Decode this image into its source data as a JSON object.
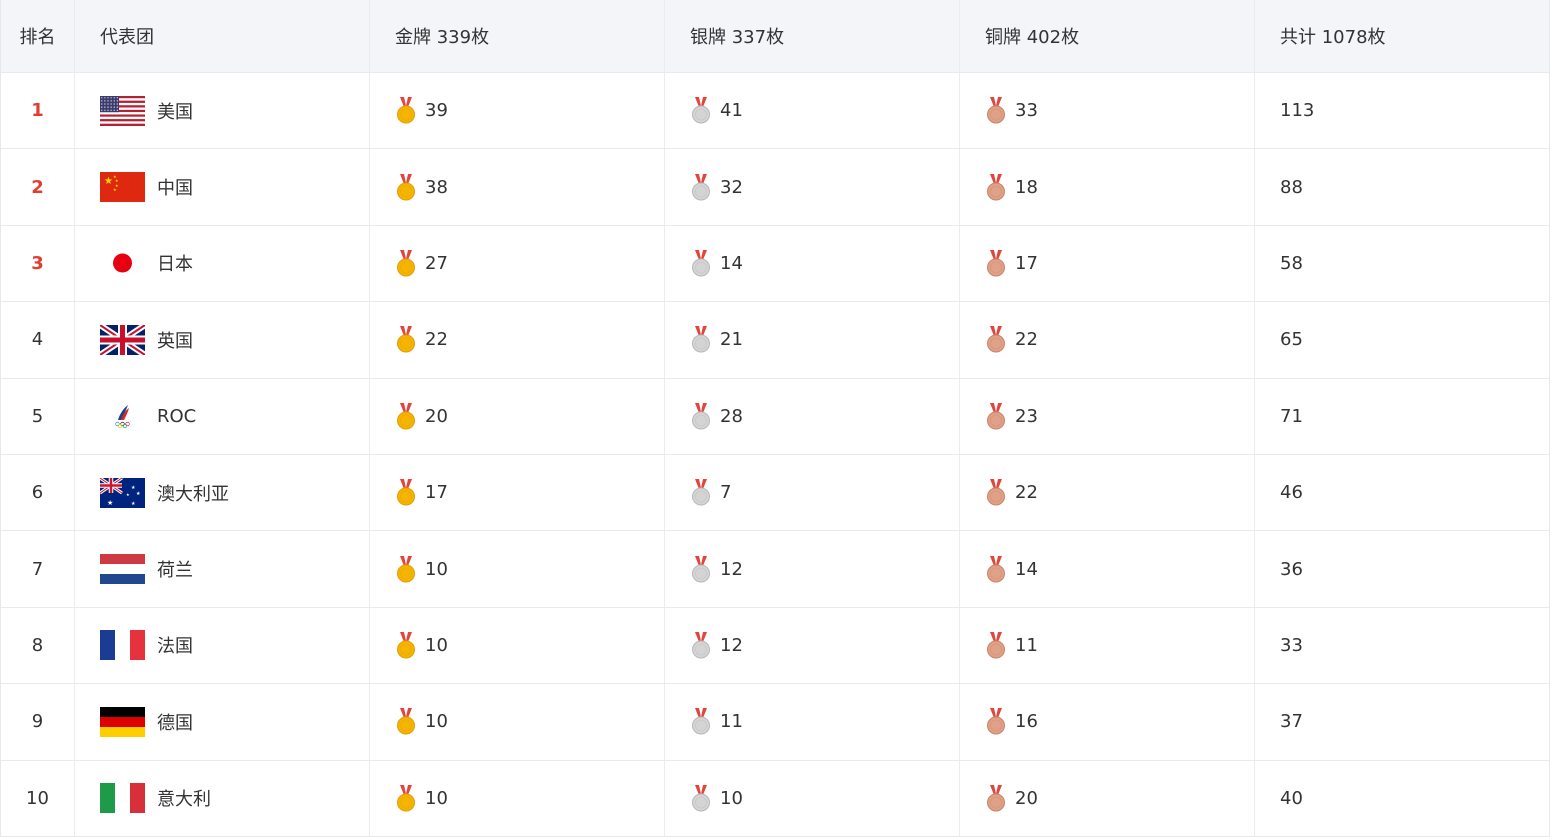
{
  "header": {
    "rank": "排名",
    "team": "代表团",
    "gold": "金牌 339枚",
    "silver": "银牌 337枚",
    "bronze": "铜牌 402枚",
    "total": "共计 1078枚"
  },
  "colors": {
    "top_rank": "#e13e2f",
    "header_bg": "#f4f5f9",
    "gold": "#f5b400",
    "silver": "#d4d4d4",
    "bronze": "#e0a189",
    "ribbon": "#e2453b"
  },
  "rows": [
    {
      "rank": "1",
      "team": "美国",
      "flag": "usa-flag-icon",
      "gold": "39",
      "silver": "41",
      "bronze": "33",
      "total": "113"
    },
    {
      "rank": "2",
      "team": "中国",
      "flag": "china-flag-icon",
      "gold": "38",
      "silver": "32",
      "bronze": "18",
      "total": "88"
    },
    {
      "rank": "3",
      "team": "日本",
      "flag": "japan-flag-icon",
      "gold": "27",
      "silver": "14",
      "bronze": "17",
      "total": "58"
    },
    {
      "rank": "4",
      "team": "英国",
      "flag": "uk-flag-icon",
      "gold": "22",
      "silver": "21",
      "bronze": "22",
      "total": "65"
    },
    {
      "rank": "5",
      "team": "ROC",
      "flag": "roc-emblem-icon",
      "gold": "20",
      "silver": "28",
      "bronze": "23",
      "total": "71"
    },
    {
      "rank": "6",
      "team": "澳大利亚",
      "flag": "australia-flag-icon",
      "gold": "17",
      "silver": "7",
      "bronze": "22",
      "total": "46"
    },
    {
      "rank": "7",
      "team": "荷兰",
      "flag": "netherlands-flag-icon",
      "gold": "10",
      "silver": "12",
      "bronze": "14",
      "total": "36"
    },
    {
      "rank": "8",
      "team": "法国",
      "flag": "france-flag-icon",
      "gold": "10",
      "silver": "12",
      "bronze": "11",
      "total": "33"
    },
    {
      "rank": "9",
      "team": "德国",
      "flag": "germany-flag-icon",
      "gold": "10",
      "silver": "11",
      "bronze": "16",
      "total": "37"
    },
    {
      "rank": "10",
      "team": "意大利",
      "flag": "italy-flag-icon",
      "gold": "10",
      "silver": "10",
      "bronze": "20",
      "total": "40"
    }
  ]
}
